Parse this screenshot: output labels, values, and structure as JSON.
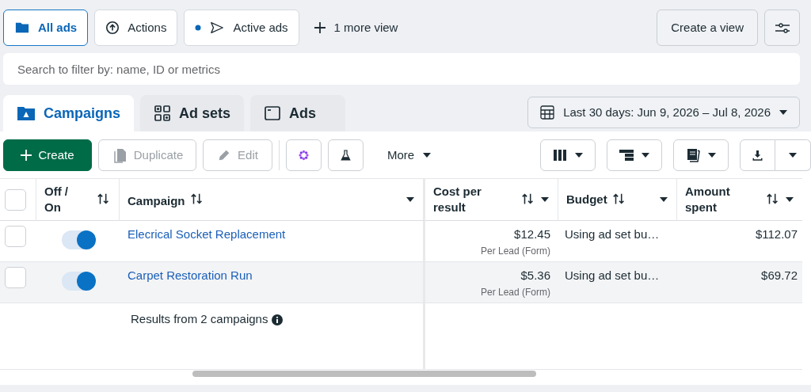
{
  "views": [
    {
      "label": "All ads",
      "selected": true
    },
    {
      "label": "Actions",
      "selected": false
    },
    {
      "label": "Active ads",
      "selected": false
    }
  ],
  "more_views": "1 more view",
  "create_view": "Create a view",
  "search": {
    "placeholder": "Search to filter by: name, ID or metrics"
  },
  "tabs": [
    {
      "label": "Campaigns",
      "selected": true
    },
    {
      "label": "Ad sets",
      "selected": false
    },
    {
      "label": "Ads",
      "selected": false
    }
  ],
  "date_range": "Last 30 days: Jun 9, 2026 – Jul 8, 2026",
  "toolbar": {
    "create": "Create",
    "duplicate": {
      "label": "Duplicate",
      "disabled": true
    },
    "edit": {
      "label": "Edit",
      "disabled": true
    },
    "more": "More"
  },
  "table": {
    "all_selected": false,
    "columns": [
      {
        "label": "Off / On"
      },
      {
        "label": "Campaign"
      },
      {
        "label": "Cost per result"
      },
      {
        "label": "Budget"
      },
      {
        "label": "Amount spent"
      }
    ],
    "rows": [
      {
        "selected": false,
        "on": true,
        "campaign": "Elecrical Socket Replacement",
        "cost": "$12.45",
        "cost_note": "Per Lead (Form)",
        "budget": "Using ad set bu…",
        "amount": "$112.07"
      },
      {
        "selected": false,
        "on": true,
        "campaign": "Carpet Restoration Run",
        "cost": "$5.36",
        "cost_note": "Per Lead (Form)",
        "budget": "Using ad set bu…",
        "amount": "$69.72"
      }
    ],
    "summary": "Results from 2 campaigns"
  }
}
